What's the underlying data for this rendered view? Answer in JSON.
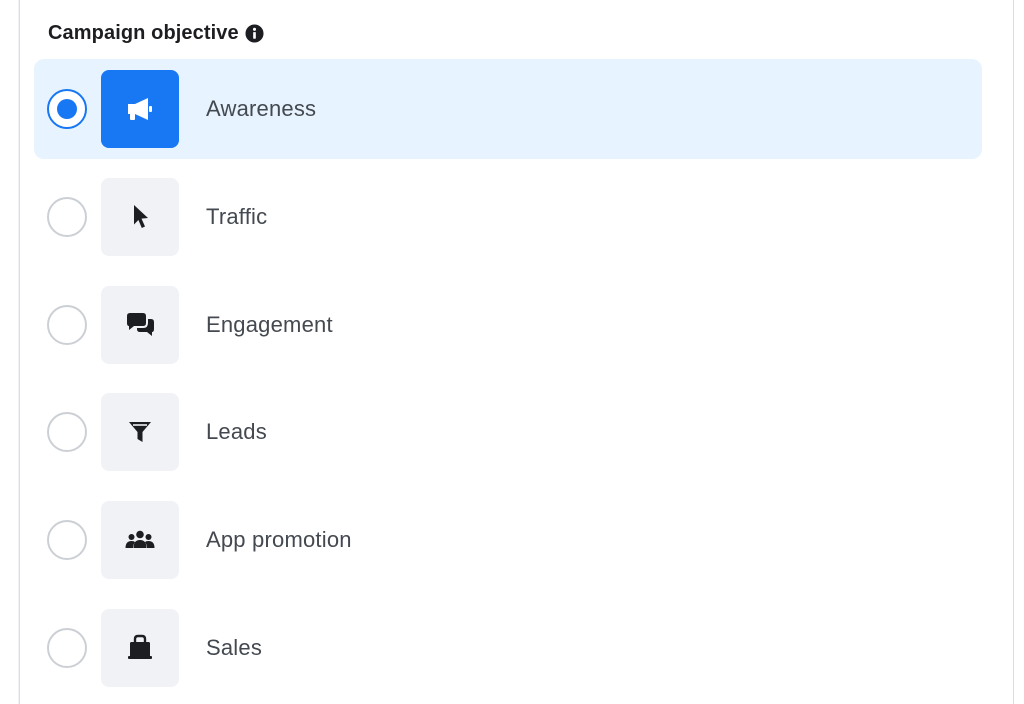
{
  "section": {
    "title": "Campaign objective",
    "info_icon": "info-circle-icon"
  },
  "selected": "awareness",
  "colors": {
    "accent": "#1877f2",
    "selected_bg": "#e7f3ff",
    "tile_bg": "#f0f2f5",
    "text": "#444950"
  },
  "options": [
    {
      "id": "awareness",
      "label": "Awareness",
      "icon": "megaphone-icon",
      "selected": true
    },
    {
      "id": "traffic",
      "label": "Traffic",
      "icon": "cursor-icon",
      "selected": false
    },
    {
      "id": "engagement",
      "label": "Engagement",
      "icon": "chat-bubbles-icon",
      "selected": false
    },
    {
      "id": "leads",
      "label": "Leads",
      "icon": "funnel-icon",
      "selected": false
    },
    {
      "id": "app_promotion",
      "label": "App promotion",
      "icon": "people-group-icon",
      "selected": false
    },
    {
      "id": "sales",
      "label": "Sales",
      "icon": "shopping-bag-icon",
      "selected": false
    }
  ]
}
